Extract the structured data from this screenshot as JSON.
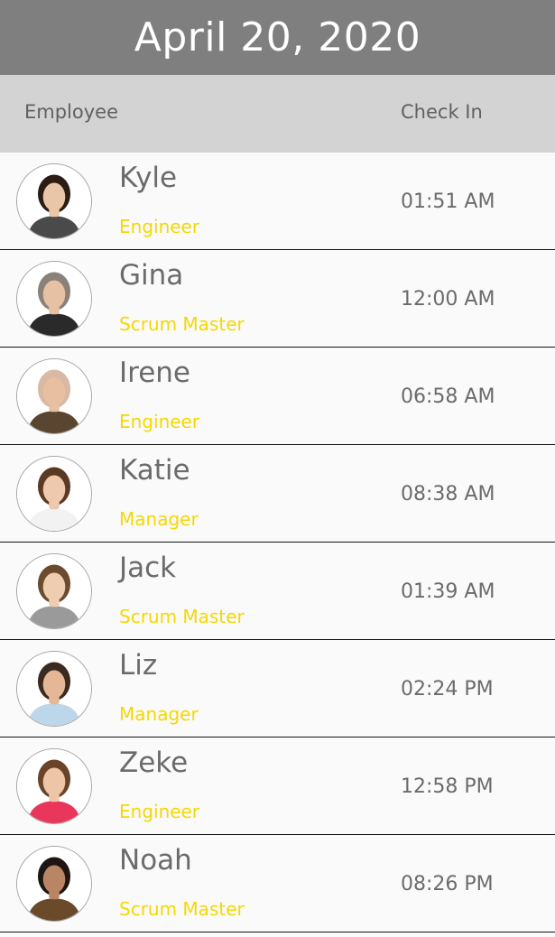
{
  "header": {
    "title": "April 20, 2020"
  },
  "columns": {
    "employee": "Employee",
    "check_in": "Check In"
  },
  "colors": {
    "title_bar": "#7f7f7f",
    "column_header": "#d3d3d3",
    "role_text": "#f5d800",
    "primary_text": "#6b6b6b"
  },
  "employees": [
    {
      "name": "Kyle",
      "role": "Engineer",
      "check_in": "01:51 AM",
      "avatar_icon": "person-photo-icon",
      "hair": "#2b1d14",
      "shirt": "#4a4a4a",
      "skin": "#e9c6a8"
    },
    {
      "name": "Gina",
      "role": "Scrum Master",
      "check_in": "12:00 AM",
      "avatar_icon": "person-photo-icon",
      "hair": "#8a8178",
      "shirt": "#2a2a2a",
      "skin": "#e6c1a4"
    },
    {
      "name": "Irene",
      "role": "Engineer",
      "check_in": "06:58 AM",
      "avatar_icon": "person-photo-icon",
      "hair": "#d9b9a3",
      "shirt": "#5a4630",
      "skin": "#e8bfa0"
    },
    {
      "name": "Katie",
      "role": "Manager",
      "check_in": "08:38 AM",
      "avatar_icon": "person-photo-icon",
      "hair": "#5b3a24",
      "shirt": "#f2f2f2",
      "skin": "#eec9ad"
    },
    {
      "name": "Jack",
      "role": "Scrum Master",
      "check_in": "01:39 AM",
      "avatar_icon": "person-photo-icon",
      "hair": "#6b4a2e",
      "shirt": "#9a9a9a",
      "skin": "#efcdb1"
    },
    {
      "name": "Liz",
      "role": "Manager",
      "check_in": "02:24 PM",
      "avatar_icon": "person-photo-icon",
      "hair": "#3a2a20",
      "shirt": "#bcd6ea",
      "skin": "#e4b896"
    },
    {
      "name": "Zeke",
      "role": "Engineer",
      "check_in": "12:58 PM",
      "avatar_icon": "person-photo-icon",
      "hair": "#6a4428",
      "shirt": "#e8375a",
      "skin": "#eec5a6"
    },
    {
      "name": "Noah",
      "role": "Scrum Master",
      "check_in": "08:26 PM",
      "avatar_icon": "person-photo-icon",
      "hair": "#1e1612",
      "shirt": "#6b4a2c",
      "skin": "#b98563"
    }
  ]
}
